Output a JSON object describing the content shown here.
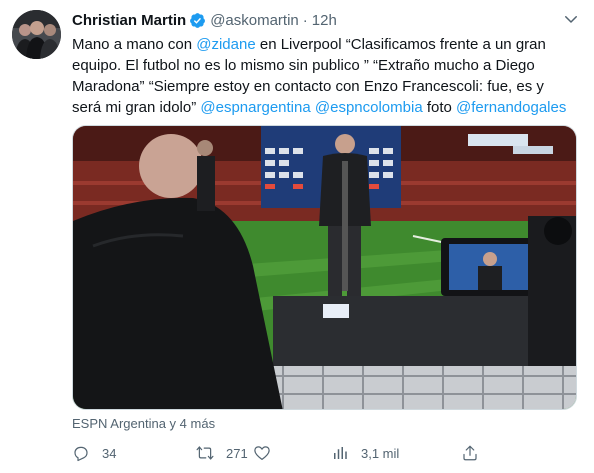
{
  "author": {
    "name": "Christian Martin",
    "handle": "@askomartin",
    "separator": "·",
    "time": "12h"
  },
  "tweet": {
    "t1": "Mano a mano con ",
    "m1": "@zidane",
    "t2": " en Liverpool “Clasificamos frente a un gran equipo. El futbol no es lo mismo sin publico ” “Extraño mucho a Diego Maradona” “Siempre estoy en contacto con Enzo Francescoli: fue, es y será mi gran idolo” ",
    "m2": "@espnargentina",
    "t3": " ",
    "m3": "@espncolombia",
    "t4": "  foto ",
    "m4": "@fernandogales"
  },
  "tagged": "ESPN Argentina y 4 más",
  "metrics": {
    "replies": "34",
    "retweets": "271",
    "likes": "",
    "views": "3,1 mil"
  },
  "colors": {
    "accent": "#1d9bf0",
    "text": "#0f1419",
    "secondary": "#536471",
    "pitch": "#3f8a2e"
  },
  "icons": [
    "verified-icon",
    "more-caret-icon",
    "reply-icon",
    "retweet-icon",
    "like-icon",
    "views-icon"
  ]
}
